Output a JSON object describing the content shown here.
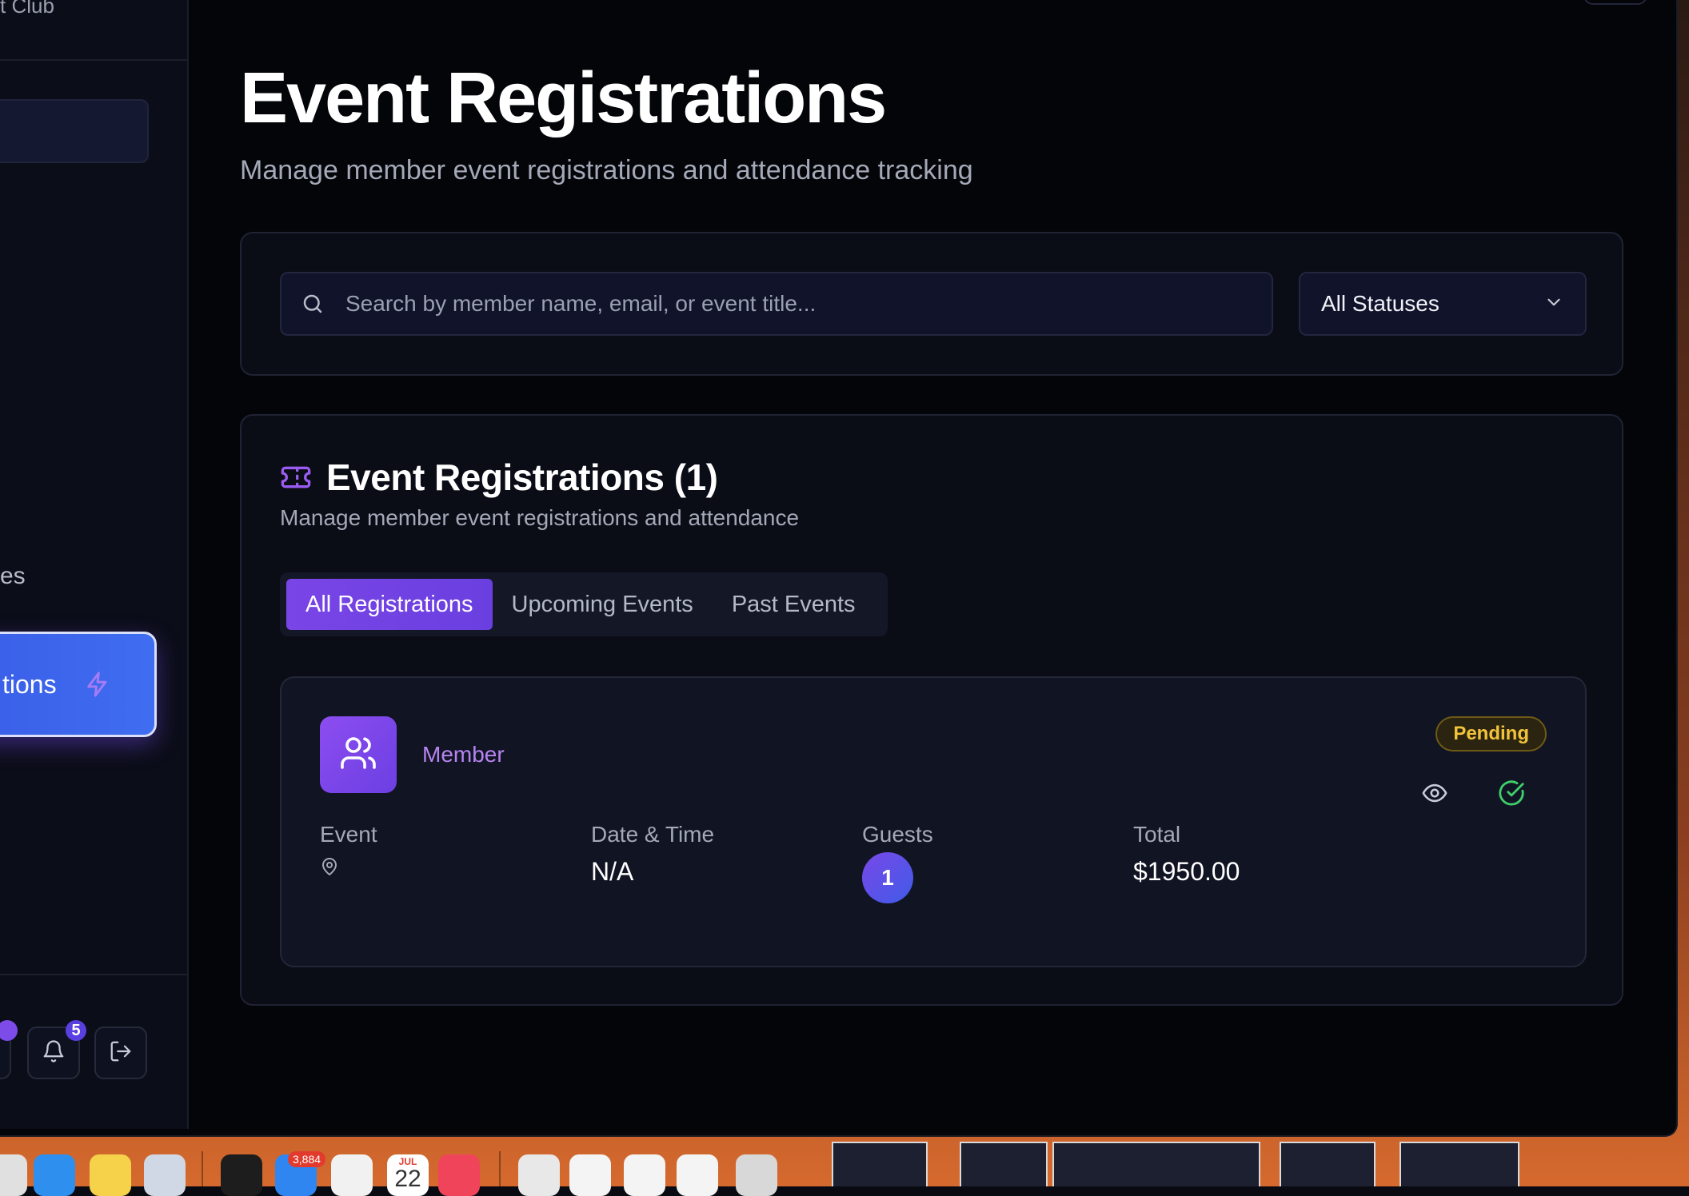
{
  "sidebar": {
    "brand_partial": "t Club",
    "section_partial": "es",
    "active_item_partial": "tions",
    "notification_count": "5"
  },
  "header": {
    "title": "Event Registrations",
    "subtitle": "Manage member event registrations and attendance tracking"
  },
  "filters": {
    "search_placeholder": "Search by member name, email, or event title...",
    "status_value": "All Statuses"
  },
  "registrations": {
    "title": "Event Registrations (1)",
    "subtitle": "Manage member event registrations and attendance",
    "tabs": [
      {
        "label": "All Registrations",
        "active": true
      },
      {
        "label": "Upcoming Events",
        "active": false
      },
      {
        "label": "Past Events",
        "active": false
      }
    ],
    "items": [
      {
        "member_label": "Member",
        "status": "Pending",
        "event_label": "Event",
        "event_value": "",
        "date_label": "Date & Time",
        "date_value": "N/A",
        "guests_label": "Guests",
        "guests_value": "1",
        "total_label": "Total",
        "total_value": "$1950.00"
      }
    ]
  },
  "dock": {
    "mail_badge": "3,884",
    "calendar_month": "JUL",
    "calendar_day": "22"
  },
  "colors": {
    "accent_purple": "#7a45e6",
    "status_pending": "#f2c33a",
    "confirm_green": "#3ecf6a",
    "active_sidebar_blue": "#3f6df0"
  }
}
